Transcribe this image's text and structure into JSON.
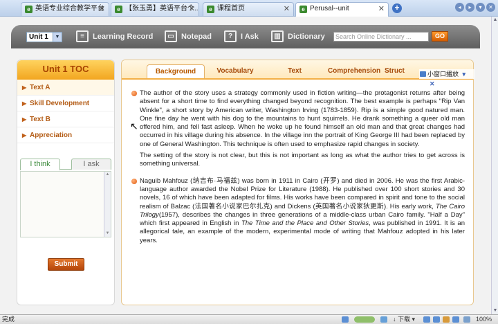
{
  "browser": {
    "tabs": [
      {
        "label": "英语专业综合教学平台"
      },
      {
        "label": "【张玉勇】英语平台个..."
      },
      {
        "label": "课程首页"
      },
      {
        "label": "Perusal--unit"
      }
    ]
  },
  "toolbar": {
    "unit_select": "Unit 1",
    "learning_record": "Learning Record",
    "notepad": "Notepad",
    "i_ask": "I Ask",
    "dictionary": "Dictionary",
    "dict_placeholder": "Search Online Dictionary ...",
    "go": "GO"
  },
  "toc": {
    "title": "Unit 1 TOC",
    "items": [
      {
        "label": "Text A"
      },
      {
        "label": "Skill Development"
      },
      {
        "label": "Text B"
      },
      {
        "label": "Appreciation"
      }
    ]
  },
  "think": {
    "tab_think": "I think",
    "tab_ask": "I ask",
    "submit": "Submit"
  },
  "content_tabs": [
    {
      "label": "Background"
    },
    {
      "label": "Vocabulary"
    },
    {
      "label": "Text"
    },
    {
      "label": "Comprehension"
    },
    {
      "label": "Struct"
    }
  ],
  "popup": {
    "label": "小窗口播放"
  },
  "paragraphs": [
    "The author of the story uses a strategy commonly used in fiction writing—the protagonist returns after being absent for a short time to find everything changed beyond recognition. The best example is perhaps \"Rip Van Winkle\", a short story by American writer, Washington Irving (1783-1859). Rip is a simple good natured man. One fine day he went with his dog to the mountains to hunt squirrels. He drank something a queer old man offered him, and fell fast asleep. When he woke up he found himself an old man and that great changes had occurred in his village during his absence. In the village inn the portrait of King George III had been replaced by one of General Washington. This technique is often used to emphasize rapid changes in society.",
    "The setting of the story is not clear, but this is not important as long as what the author tries to get across is something universal."
  ],
  "para2": {
    "a": "Naguib Mahfouz (纳吉布·马福兹) was born in 1911 in Cairo (开罗) and died in 2006. He was the first Arabic-language author awarded the Nobel Prize for Literature (1988). He published over 100 short stories and 30 novels, 16 of which have been adapted for films. His works have been compared in spirit and tone to the social realism of Balzac (法国著名小说家巴尔扎克) and Dickens (英国著名小说家狄更斯). His early work, ",
    "b": "The Cairo Trilogy",
    "c": "(1957), describes the changes in three generations of a middle-class urban Cairo family. \"Half a Day\" which first appeared in English in ",
    "d": "The Time and the Place and Other Stories",
    "e": ", was published in 1991. It is an allegorical tale, an example of the modern, experimental mode of writing that Mahfouz adopted in his later years."
  },
  "statusbar": {
    "done": "完成",
    "download": "下载",
    "zoom": "100%"
  },
  "icons": {
    "record": "notebook-icon",
    "notepad": "notepad-icon",
    "ask": "speech-bubble-icon",
    "dictionary": "book-icon"
  }
}
